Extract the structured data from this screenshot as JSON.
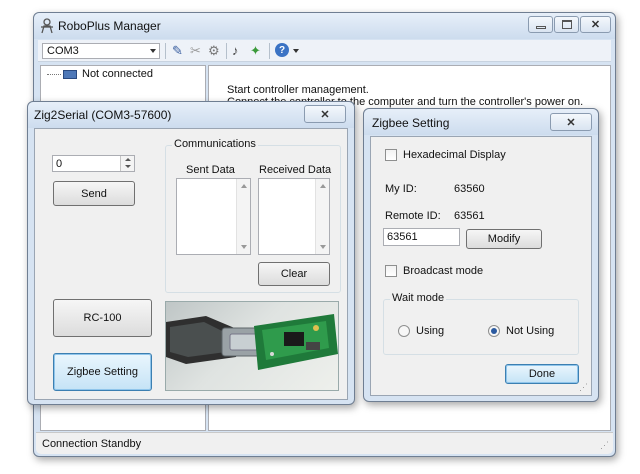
{
  "main_window": {
    "title": "RoboPlus Manager",
    "port_select": "COM3",
    "tree_item": "Not connected",
    "message_line1": "Start controller management.",
    "message_line2": "Connect the controller to the computer and turn the controller's power on.",
    "status": "Connection Standby",
    "icons": [
      "robot-icon",
      "dropdown-arrow-icon",
      "connect-pen-icon",
      "disconnect-icon",
      "settings-icon",
      "sound-icon",
      "firmware-icon",
      "help-icon"
    ]
  },
  "zig2serial": {
    "title": "Zig2Serial (COM3-57600)",
    "close_label": "✕",
    "number_value": "0",
    "send_label": "Send",
    "communications_label": "Communications",
    "sent_data_label": "Sent Data",
    "received_data_label": "Received Data",
    "clear_label": "Clear",
    "rc100_label": "RC-100",
    "zigbee_setting_label": "Zigbee Setting"
  },
  "zigbee_setting": {
    "title": "Zigbee Setting",
    "close_label": "✕",
    "hex_display_label": "Hexadecimal Display",
    "my_id_label": "My ID:",
    "my_id_value": "63560",
    "remote_id_label": "Remote ID:",
    "remote_id_value": "63561",
    "remote_input_value": "63561",
    "modify_label": "Modify",
    "broadcast_label": "Broadcast mode",
    "wait_mode_label": "Wait mode",
    "using_label": "Using",
    "not_using_label": "Not Using",
    "selected_wait_mode": "Not Using",
    "done_label": "Done"
  },
  "colors": {
    "title_bg": "#d6e3f2",
    "client_bg": "#f0f0f0",
    "accent_blue": "#2b5aa0"
  }
}
